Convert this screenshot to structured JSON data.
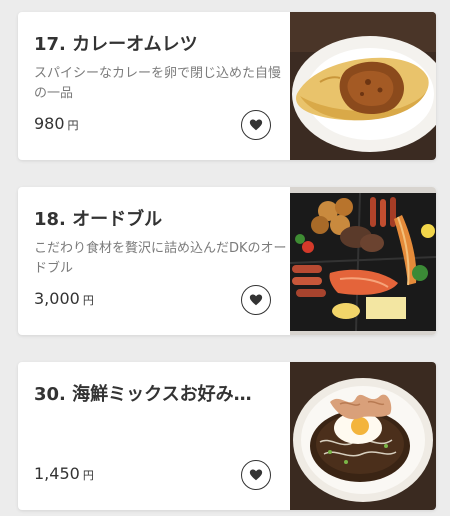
{
  "menu_items": [
    {
      "name": "17. カレーオムレツ",
      "description": "スパイシーなカレーを卵で閉じ込めた自慢の一品",
      "price": "980",
      "currency": "円",
      "favorite_icon": "heart-icon"
    },
    {
      "name": "18. オードブル",
      "description": "こだわり食材を贅沢に詰め込んだDKのオードブル",
      "price": "3,000",
      "currency": "円",
      "favorite_icon": "heart-icon"
    },
    {
      "name": "30. 海鮮ミックスお好み…",
      "description": "",
      "price": "1,450",
      "currency": "円",
      "favorite_icon": "heart-icon"
    }
  ]
}
